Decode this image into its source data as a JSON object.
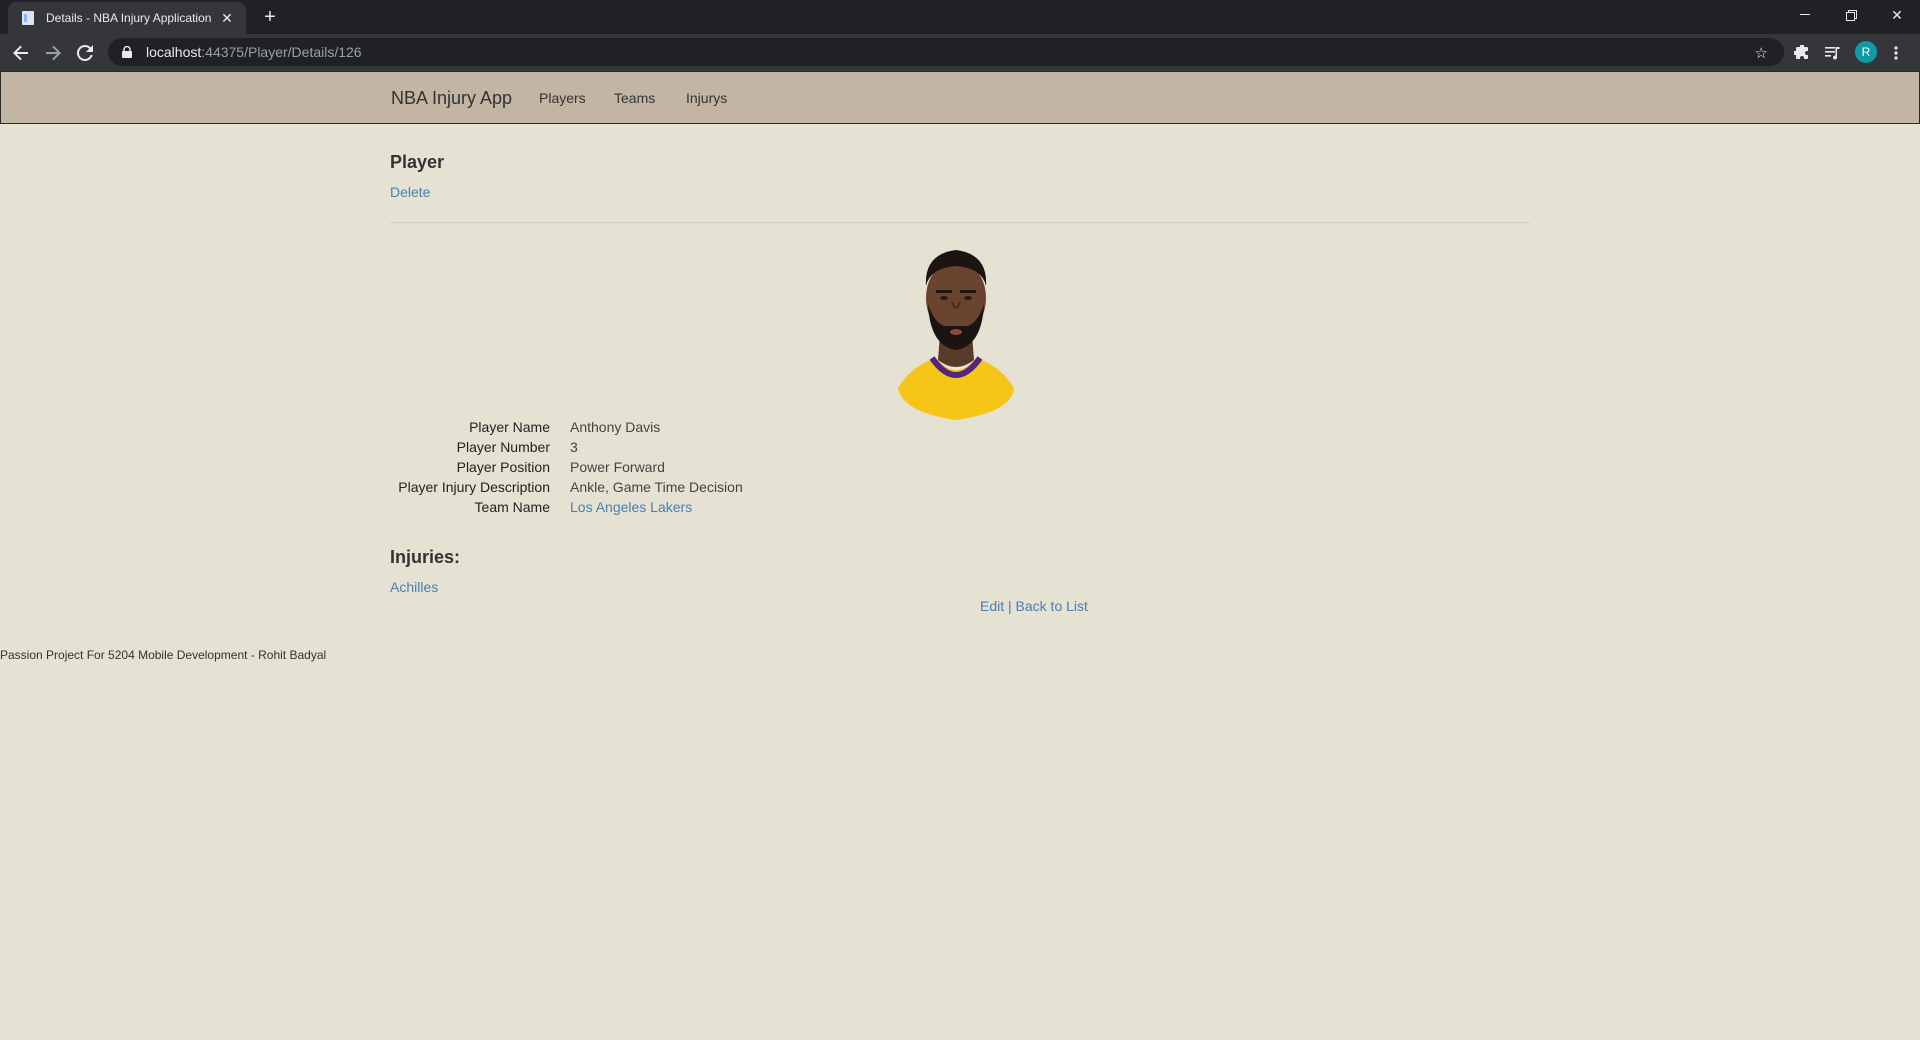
{
  "browser": {
    "tab_title": "Details - NBA Injury Application",
    "url_host": "localhost",
    "url_rest": ":44375/Player/Details/126",
    "avatar_initial": "R"
  },
  "nav": {
    "brand": "NBA Injury App",
    "links": [
      "Players",
      "Teams",
      "Injurys"
    ]
  },
  "page": {
    "title": "Player",
    "delete_label": "Delete"
  },
  "player": {
    "fields": [
      {
        "label": "Player Name",
        "value": "Anthony Davis"
      },
      {
        "label": "Player Number",
        "value": "3"
      },
      {
        "label": "Player Position",
        "value": "Power Forward"
      },
      {
        "label": "Player Injury Description",
        "value": "Ankle, Game Time Decision"
      },
      {
        "label": "Team Name",
        "value": "Los Angeles Lakers"
      }
    ],
    "jersey_color": "#f5c518",
    "jersey_trim": "#552583"
  },
  "injuries": {
    "heading": "Injuries:",
    "items": [
      "Achilles"
    ]
  },
  "actions": {
    "edit_label": "Edit",
    "separator": "|",
    "back_label": "Back to List"
  },
  "footer": {
    "text": "Passion Project For 5204 Mobile Development - Rohit Badyal"
  }
}
